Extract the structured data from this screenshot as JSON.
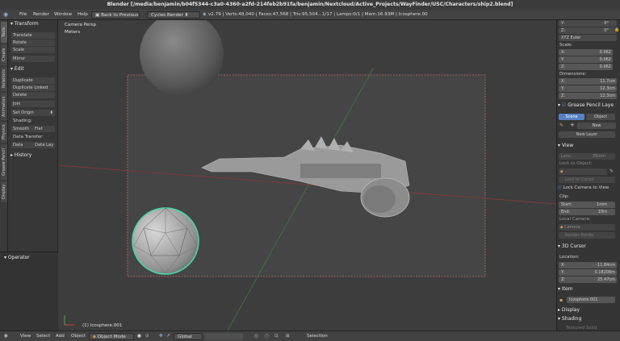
{
  "title": "Blender [/media/benjamin/b04f5344-c3a0-4360-a2fd-214feb2b91fa/benjamin/Nextcloud/Active_Projects/WayFinder/USC/Characters/ship2.blend]",
  "header": {
    "menu": [
      "File",
      "Render",
      "Window",
      "Help"
    ],
    "back_button": "Back to Previous",
    "engine": "Cycles Render",
    "stats": "v2.79 | Verts:48,040 | Faces:47,568 | Tris:95,504...1/17 | Lamps:0/1 | Mem:16.93M | Icosphere.00"
  },
  "tabs": [
    "Tools",
    "Create",
    "Relations",
    "Animation",
    "Physics",
    "Grease Pencil",
    "Display"
  ],
  "tools": {
    "transform_header": "Transform",
    "transform_buttons": [
      "Translate",
      "Rotate",
      "Scale",
      "Mirror"
    ],
    "edit_header": "Edit",
    "edit_buttons": [
      "Duplicate",
      "Duplicate Linked",
      "Delete",
      "Join",
      "Set Origin"
    ],
    "shading_label": "Shading:",
    "shading_buttons": [
      "Smooth",
      "Flat"
    ],
    "data_transfer_label": "Data Transfer:",
    "data_transfer_buttons": [
      "Data",
      "Data Lay"
    ],
    "history_header": "History",
    "operator_header": "Operator"
  },
  "viewport": {
    "view_name": "Camera Persp",
    "units": "Meters",
    "object_label": "(1) Icosphere.001"
  },
  "props": {
    "rot_y": "0°",
    "rot_z": "0°",
    "rot_mode": "XYZ Euler",
    "scale_label": "Scale:",
    "scale": [
      {
        "axis": "X:",
        "value": "0.062"
      },
      {
        "axis": "Y:",
        "value": "0.062"
      },
      {
        "axis": "Z:",
        "value": "0.062"
      }
    ],
    "dimensions_label": "Dimensions:",
    "dimensions": [
      {
        "axis": "X:",
        "value": "11.7cm"
      },
      {
        "axis": "Y:",
        "value": "12.3cm"
      },
      {
        "axis": "Z:",
        "value": "12.3cm"
      }
    ],
    "grease_pencil_header": "Grease Pencil Laye",
    "gp_scene": "Scene",
    "gp_object": "Object",
    "gp_new": "New",
    "gp_new_layer": "New Layer",
    "view_header": "View",
    "lens_label": "Lens:",
    "lens_value": "35mm",
    "lock_to_object": "Lock to Object:",
    "lock_to_cursor": "Lock to Cursor",
    "lock_camera": "Lock Camera to View",
    "clip_label": "Clip:",
    "clip_start_label": "Start:",
    "clip_start": "1mm",
    "clip_end_label": "End:",
    "clip_end": "10m",
    "local_camera": "Local Camera:",
    "camera_value": "Camera",
    "render_border": "Render Border",
    "cursor_header": "3D Cursor",
    "location_label": "Location:",
    "location": [
      {
        "axis": "X:",
        "value": "-11.84cm"
      },
      {
        "axis": "Y:",
        "value": "0.18208m"
      },
      {
        "axis": "Z:",
        "value": "25.47cm"
      }
    ],
    "item_header": "Item",
    "item_name": "Icosphere.001",
    "display_header": "Display",
    "shading_header": "Shading",
    "textured_solid": "Textured Solid"
  },
  "bottom": {
    "menu": [
      "View",
      "Select",
      "Add",
      "Object"
    ],
    "mode": "Object Mode",
    "pivot": "Global",
    "selection": "Selection"
  },
  "colors": {
    "accent_blue": "#5680c2",
    "selection_outline": "#45d6a5",
    "camera_frame": "#c56a6a"
  }
}
